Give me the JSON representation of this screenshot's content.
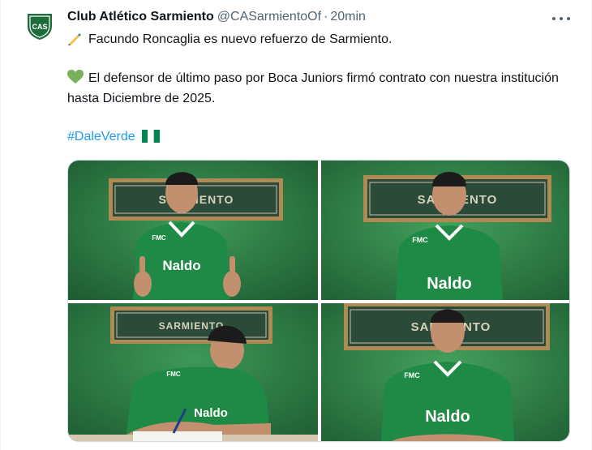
{
  "tweet": {
    "author_name": "Club Atlético Sarmiento",
    "handle": "@CASarmientoOf",
    "separator": "·",
    "time": "20min",
    "avatar_letters": "CAS",
    "line1": "Facundo Roncaglia es nuevo refuerzo de Sarmiento.",
    "line2": "El defensor de último paso por Boca Juniors firmó contrato con nuestra institución hasta Diciembre de 2025.",
    "hashtag": "#DaleVerde",
    "icons": {
      "more": "more-icon",
      "writing_hand": "writing-hand-icon",
      "green_heart": "green-heart-icon",
      "flag": "nigeria-flag-icon"
    }
  },
  "photos": {
    "banner_text": "SARMIENTO",
    "sponsor": "Naldo",
    "kit_brand": "FMC",
    "colors": {
      "wall": "#2f7d44",
      "jersey": "#1f8a45",
      "banner_frame": "#b08a55",
      "banner_bg": "#2c4a3a"
    }
  },
  "colors": {
    "accent": "#1d9bf0",
    "club_green": "#1e6b3c",
    "secondary_text": "#536471"
  }
}
